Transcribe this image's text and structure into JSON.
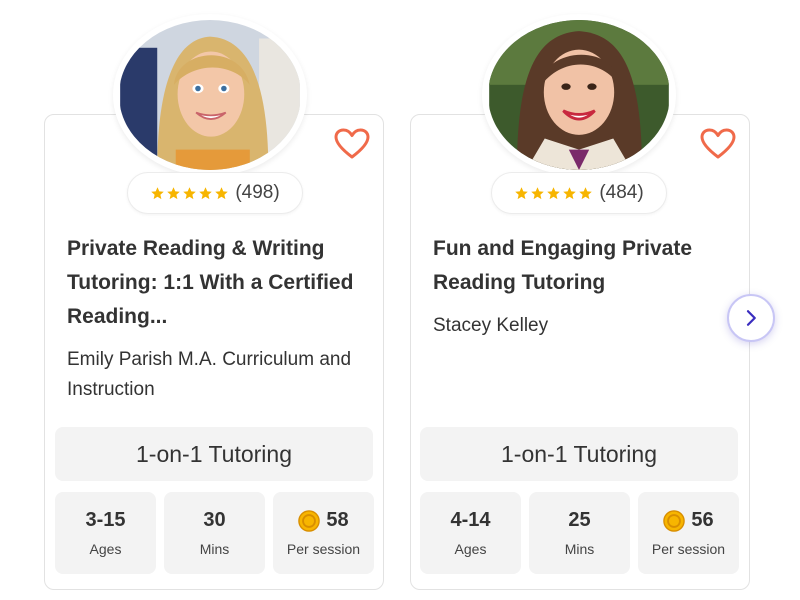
{
  "colors": {
    "heart": "#f06a4a",
    "star": "#f7b500",
    "coin": "#f7b500",
    "accent": "#3a2dbf"
  },
  "cards": [
    {
      "avatar_alt": "Emily Parish",
      "rating_count": "(498)",
      "title": "Private Reading & Writing Tutoring: 1:1 With a Certified Reading...",
      "teacher": "Emily Parish M.A. Curriculum and Instruction",
      "format": "1-on-1 Tutoring",
      "stats": [
        {
          "value": "3-15",
          "label": "Ages"
        },
        {
          "value": "30",
          "label": "Mins"
        },
        {
          "value": "58",
          "label": "Per session"
        }
      ]
    },
    {
      "avatar_alt": "Stacey Kelley",
      "rating_count": "(484)",
      "title": "Fun and Engaging Private Reading Tutoring",
      "teacher": "Stacey Kelley",
      "format": "1-on-1 Tutoring",
      "stats": [
        {
          "value": "4-14",
          "label": "Ages"
        },
        {
          "value": "25",
          "label": "Mins"
        },
        {
          "value": "56",
          "label": "Per session"
        }
      ]
    }
  ],
  "icons": {
    "favorite": "heart-icon",
    "rating": "star-icon",
    "price": "coin-icon",
    "next": "chevron-right-icon"
  }
}
